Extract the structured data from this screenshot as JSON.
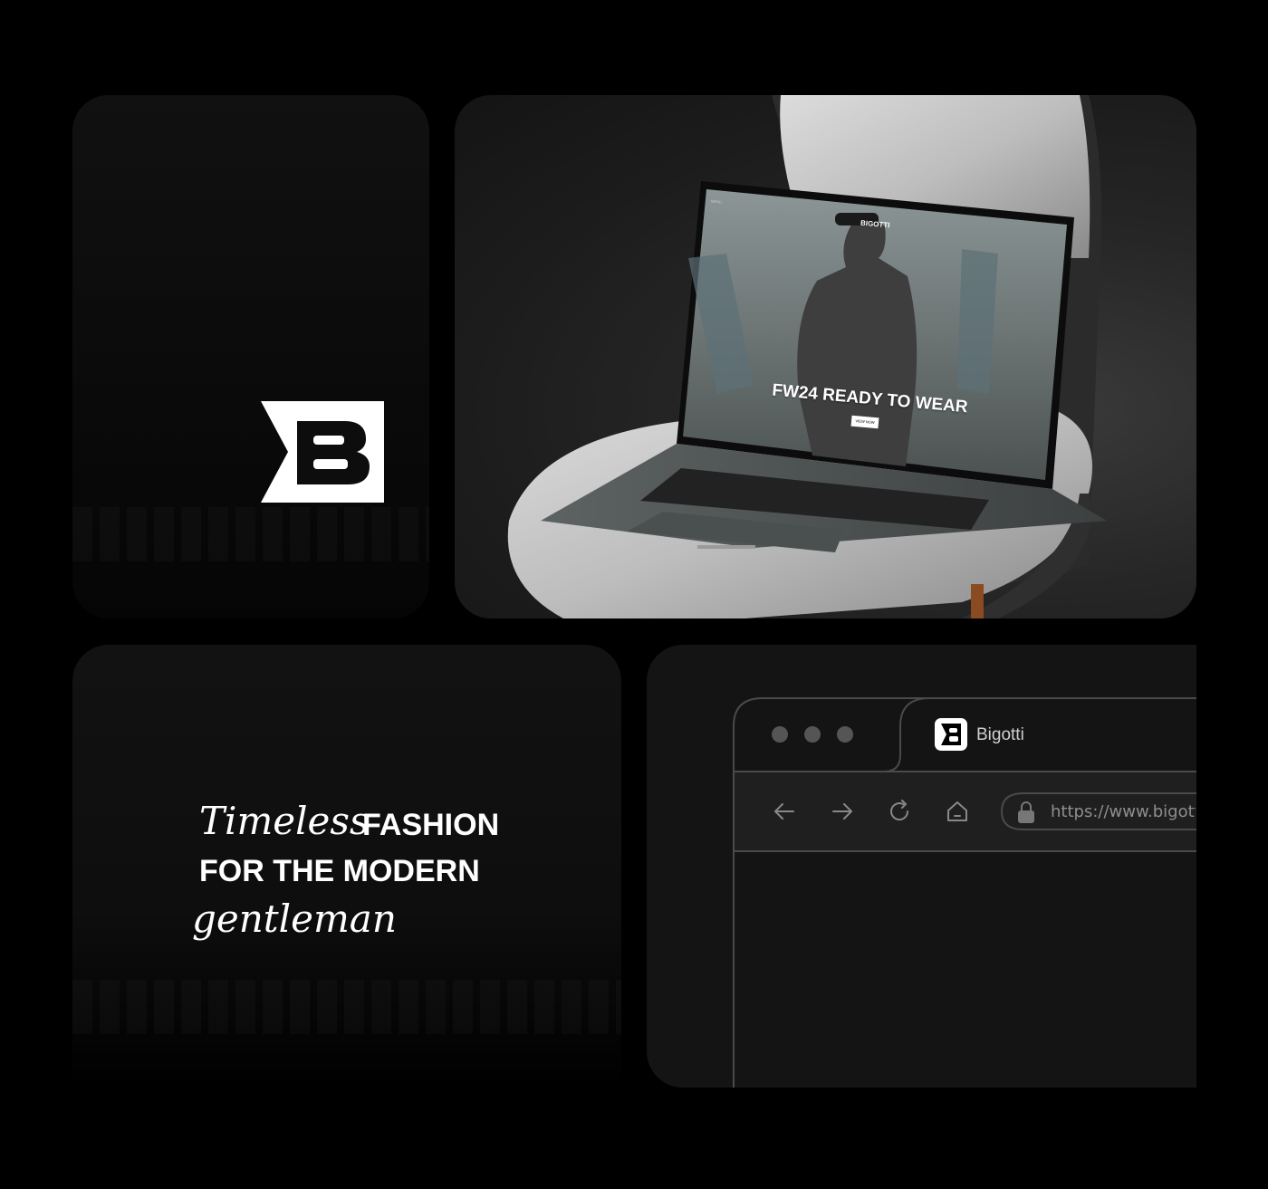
{
  "logo": {
    "letter": "B",
    "brand": "Bigotti"
  },
  "laptop_screen": {
    "brand": "BIGOTTI",
    "headline": "FW24 READY TO WEAR",
    "cta": "VIEW NOW",
    "menu": "MENU"
  },
  "tagline": {
    "line1_script": "Timeless",
    "line1_bold": "FASHION",
    "line2_bold": "FOR THE MODERN",
    "line3_script": "gentleman"
  },
  "browser": {
    "tab_title": "Bigotti",
    "url": "https://www.bigotti",
    "icons": [
      "back-arrow-icon",
      "forward-arrow-icon",
      "reload-icon",
      "home-icon",
      "lock-icon"
    ]
  },
  "colors": {
    "background": "#000000",
    "card": "#121212",
    "text": "#ffffff",
    "browser_stroke": "#4a4a4a"
  }
}
